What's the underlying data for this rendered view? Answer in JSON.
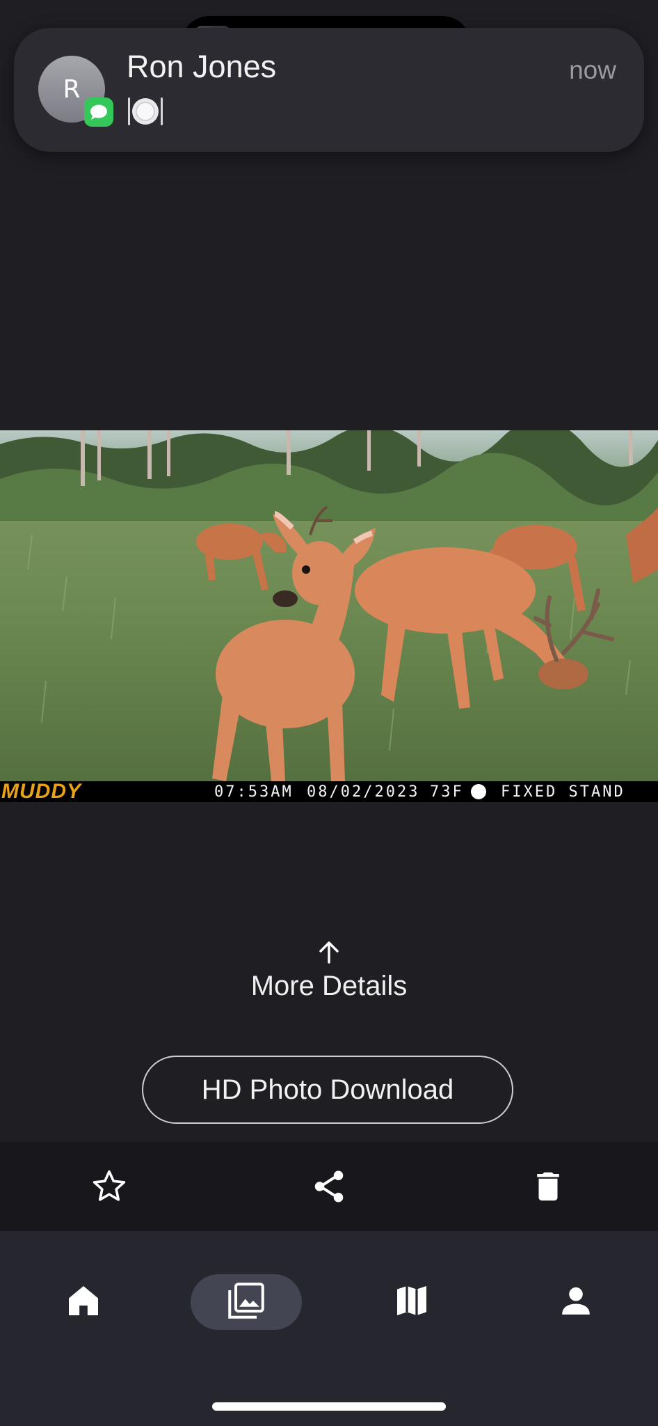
{
  "notification": {
    "avatar_letter": "R",
    "sender": "Ron Jones",
    "message": "🍽",
    "time": "now",
    "app_icon": "messages-icon"
  },
  "dynamic_island": {
    "now_playing_icon": "album-art-icon",
    "activity_icon": "waveform-icon"
  },
  "photo": {
    "brand": "MUDDY",
    "time": "07:53AM",
    "date": "08/02/2023",
    "temperature": "73F",
    "moon_phase_icon": "full-moon-icon",
    "location": "FIXED STAND"
  },
  "details": {
    "label": "More Details",
    "icon": "arrow-up-icon"
  },
  "hd_download": {
    "label": "HD Photo Download"
  },
  "actions": {
    "favorite_icon": "star-outline-icon",
    "share_icon": "share-icon",
    "delete_icon": "trash-icon"
  },
  "tabs": [
    {
      "name": "home",
      "icon": "home-icon",
      "active": false
    },
    {
      "name": "photos",
      "icon": "photo-library-icon",
      "active": true
    },
    {
      "name": "map",
      "icon": "map-icon",
      "active": false
    },
    {
      "name": "profile",
      "icon": "person-icon",
      "active": false
    }
  ],
  "colors": {
    "background": "#1f1e23",
    "tab_bar": "#26262f",
    "active_tab": "#434552",
    "badge_green": "#34c759",
    "brand_orange": "#e8a21a"
  }
}
